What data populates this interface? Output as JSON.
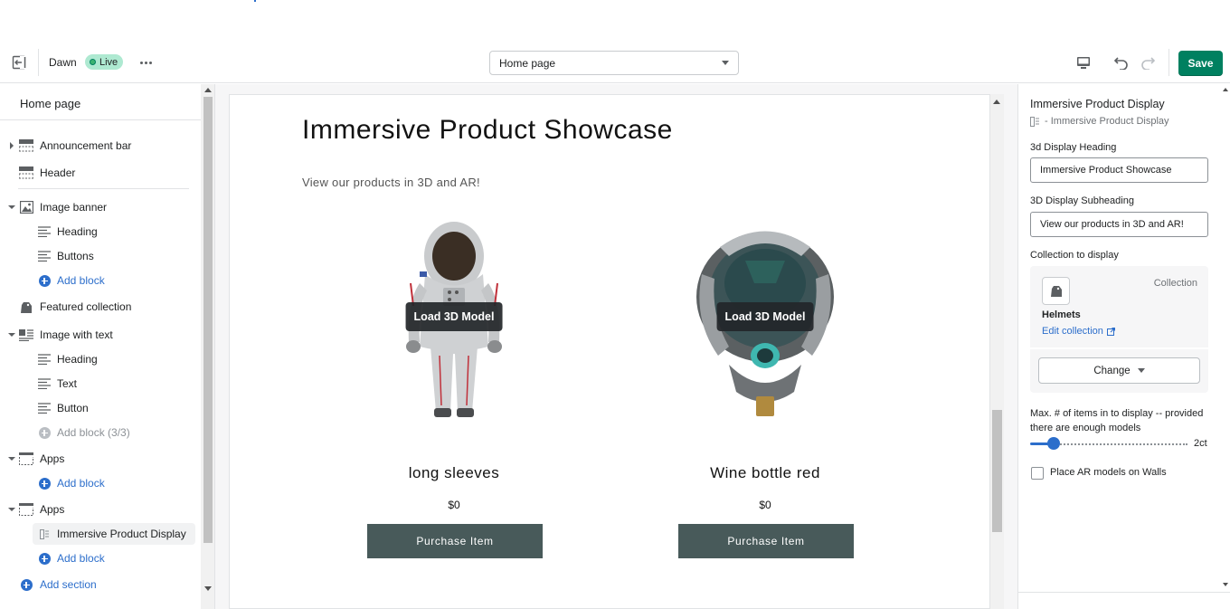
{
  "topbar": {
    "theme_name": "Dawn",
    "live_badge": "Live",
    "page_select": "Home page",
    "save_label": "Save"
  },
  "sidebar": {
    "title": "Home page",
    "items": [
      {
        "label": "Announcement bar",
        "icon": "section-icon"
      },
      {
        "label": "Header",
        "icon": "section-icon"
      },
      {
        "label": "Image banner",
        "icon": "image-icon"
      },
      {
        "label": "Heading",
        "icon": "text-lines-icon"
      },
      {
        "label": "Buttons",
        "icon": "text-lines-icon"
      },
      {
        "label": "Add block",
        "icon": "add-circle-icon"
      },
      {
        "label": "Featured collection",
        "icon": "tag-icon"
      },
      {
        "label": "Image with text",
        "icon": "image-text-icon"
      },
      {
        "label": "Heading",
        "icon": "text-lines-icon"
      },
      {
        "label": "Text",
        "icon": "text-lines-icon"
      },
      {
        "label": "Button",
        "icon": "text-lines-icon"
      },
      {
        "label": "Add block (3/3)",
        "icon": "add-circle-icon"
      },
      {
        "label": "Apps",
        "icon": "apps-icon"
      },
      {
        "label": "Add block",
        "icon": "add-circle-icon"
      },
      {
        "label": "Apps",
        "icon": "apps-icon"
      },
      {
        "label": "Immersive Product Display",
        "icon": "app-block-icon"
      },
      {
        "label": "Add block",
        "icon": "add-circle-icon"
      },
      {
        "label": "Add section",
        "icon": "add-circle-icon"
      }
    ]
  },
  "preview": {
    "heading": "Immersive Product Showcase",
    "subheading": "View our products in 3D and AR!",
    "products": [
      {
        "name": "long sleeves",
        "price": "$0",
        "load_label": "Load 3D Model",
        "buy_label": "Purchase Item"
      },
      {
        "name": "Wine bottle red",
        "price": "$0",
        "load_label": "Load 3D Model",
        "buy_label": "Purchase Item"
      }
    ]
  },
  "panel": {
    "title": "Immersive Product Display",
    "subtitle": "- Immersive Product Display",
    "heading_label": "3d Display Heading",
    "heading_value": "Immersive Product Showcase",
    "subheading_label": "3D Display Subheading",
    "subheading_value": "View our products in 3D and AR!",
    "collection_label": "Collection to display",
    "collection_type": "Collection",
    "collection_name": "Helmets",
    "edit_collection": "Edit collection",
    "change_label": "Change",
    "max_items_label": "Max. # of items in to display -- provided there are enough models",
    "max_items_value": "2ct",
    "max_items_fraction": 0.15,
    "ar_walls_label": "Place AR models on Walls",
    "ar_walls_checked": false
  },
  "colors": {
    "save_green": "#008060",
    "live_badge": "#aee9d1",
    "link_blue": "#2c6ecb",
    "buy_button": "#485a5a"
  }
}
